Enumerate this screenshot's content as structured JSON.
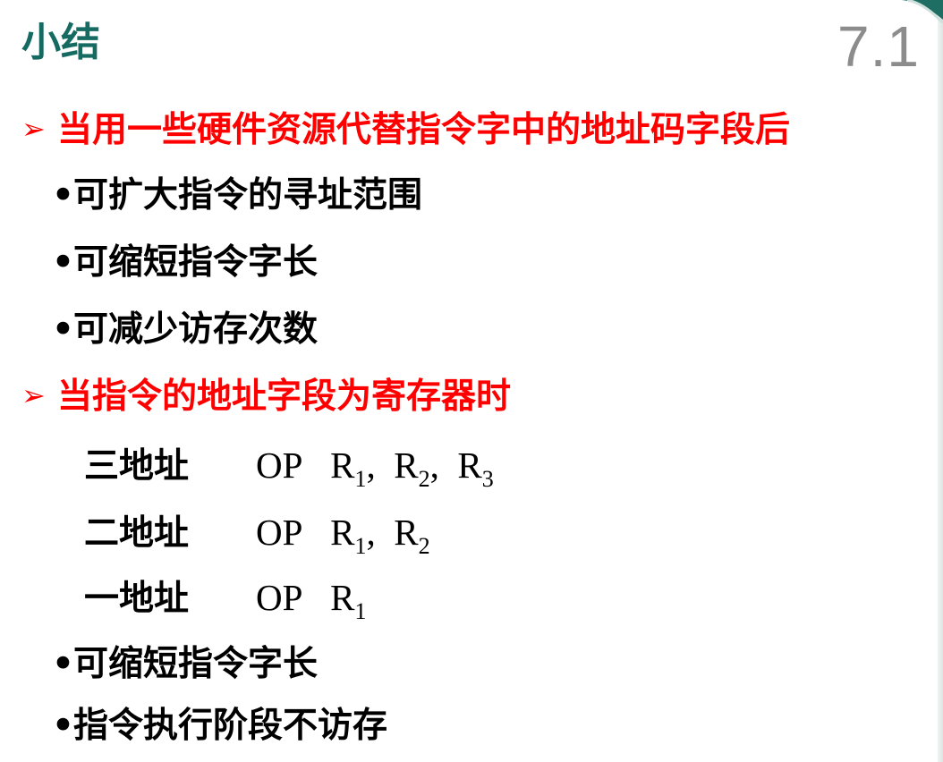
{
  "title": "小结",
  "section_number": "7.1",
  "section1": {
    "heading": "当用一些硬件资源代替指令字中的地址码字段后",
    "bullets": [
      "可扩大指令的寻址范围",
      "可缩短指令字长",
      "可减少访存次数"
    ]
  },
  "section2": {
    "heading": "当指令的地址字段为寄存器时",
    "rows": [
      {
        "label": "三地址",
        "op": "OP",
        "regs": [
          "1",
          "2",
          "3"
        ]
      },
      {
        "label": "二地址",
        "op": "OP",
        "regs": [
          "1",
          "2"
        ]
      },
      {
        "label": "一地址",
        "op": "OP",
        "regs": [
          "1"
        ]
      }
    ],
    "bullets": [
      "可缩短指令字长",
      "指令执行阶段不访存"
    ]
  },
  "colors": {
    "title": "#156b62",
    "heading": "#ff0000",
    "section_number": "#8c8c8c"
  },
  "icons": [
    "arrow-bullet-icon",
    "dot-bullet-icon"
  ]
}
